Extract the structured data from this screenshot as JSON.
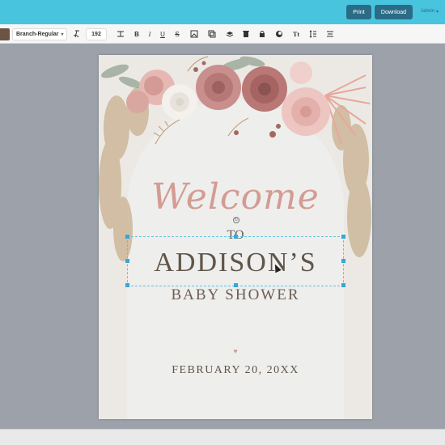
{
  "topbar": {
    "print_label": "Print",
    "download_label": "Download",
    "admin_label": "Admin",
    "accent_color": "#48c4df",
    "button_color": "#2b6b86"
  },
  "toolbar": {
    "font_name": "Branch-Regular",
    "font_size": "192",
    "text_color": "#6b5443",
    "icons": [
      "text-effects-icon",
      "letter-spacing-icon",
      "bold-icon",
      "italic-icon",
      "underline-icon",
      "strikethrough-icon",
      "image-icon",
      "duplicate-icon",
      "layers-icon",
      "delete-icon",
      "lock-icon",
      "color-fill-icon",
      "text-transform-icon",
      "line-height-icon",
      "align-icon"
    ]
  },
  "canvas": {
    "welcome": "Welcome",
    "to": "TO",
    "name": "ADDISON’S",
    "shower": "BABY SHOWER",
    "date": "FEBRUARY 20, 20XX",
    "accent_color": "#d39c93"
  }
}
